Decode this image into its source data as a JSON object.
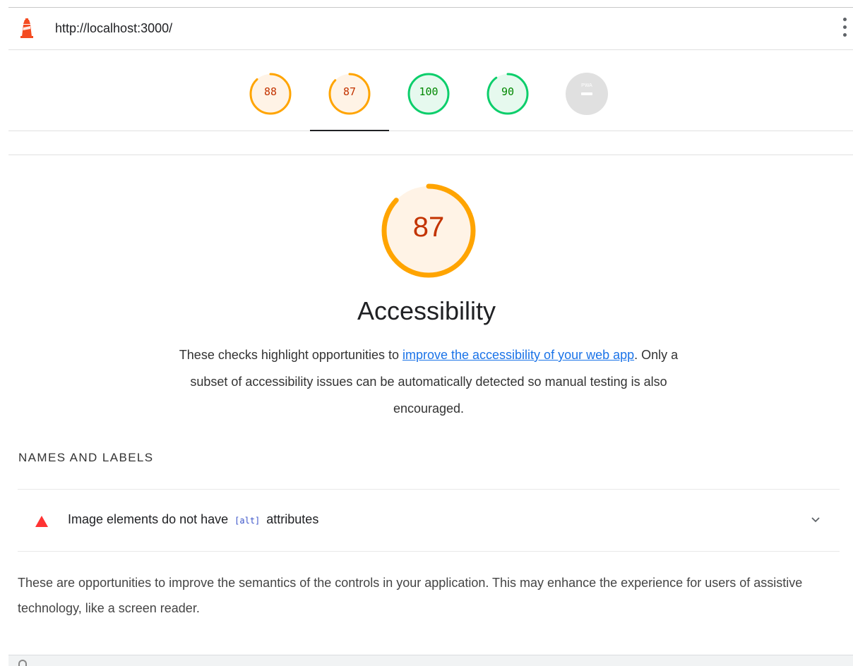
{
  "header": {
    "url": "http://localhost:3000/"
  },
  "gauges": [
    {
      "value": "88",
      "score": 0.88,
      "status": "average"
    },
    {
      "value": "87",
      "score": 0.87,
      "status": "average",
      "selected": true
    },
    {
      "value": "100",
      "score": 1.0,
      "status": "pass"
    },
    {
      "value": "90",
      "score": 0.9,
      "status": "pass"
    },
    {
      "value": "",
      "label": "PWA",
      "status": "na"
    }
  ],
  "category": {
    "score": "87",
    "score_fraction": 0.87,
    "title": "Accessibility",
    "description_before": "These checks highlight opportunities to ",
    "description_link": "improve the accessibility of your web app",
    "description_after": ". Only a subset of accessibility issues can be automatically detected so manual testing is also encouraged."
  },
  "group": {
    "title": "NAMES AND LABELS",
    "audit": {
      "title_before": "Image elements do not have ",
      "title_code": "[alt]",
      "title_after": " attributes"
    },
    "description": "These are opportunities to improve the semantics of the controls in your application. This may enhance the experience for users of assistive technology, like a screen reader."
  },
  "colors": {
    "average_ring": "#ffa400",
    "average_fill": "#fff3e6",
    "average_text": "#c33300",
    "pass_ring": "#0cce6b",
    "pass_fill": "#e6f9ee",
    "pass_text": "#008800",
    "na_fill": "#e0e0e0",
    "link": "#1a73e8",
    "fail": "#ff3333"
  }
}
